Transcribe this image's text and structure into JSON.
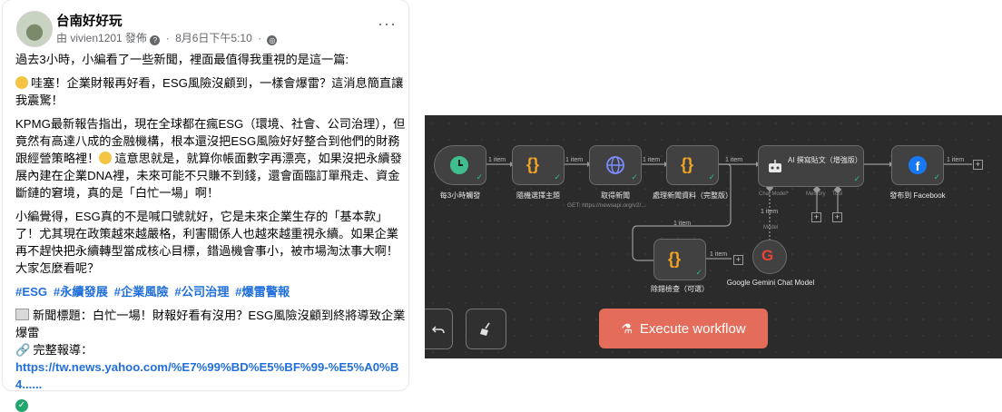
{
  "post": {
    "page_name": "台南好好玩",
    "byline": "由 vivien1201 發佈",
    "time": "8月6日下午5:10",
    "paragraphs": [
      "過去3小時，小編看了一些新聞，裡面最值得我重視的是這一篇:",
      "哇塞！企業財報再好看，ESG風險沒顧到，一樣會爆雷？這消息簡直讓我震驚！",
      "KPMG最新報告指出，現在全球都在瘋ESG（環境、社會、公司治理），但竟然有高達八成的金融機構，根本還沒把ESG風險好好整合到他們的財務跟經營策略裡！",
      "這意思就是，就算你帳面數字再漂亮，如果沒把永續發展內建在企業DNA裡，未來可能不只賺不到錢，還會面臨訂單飛走、資金斷鏈的窘境，真的是「白忙一場」啊！",
      "小編覺得，ESG真的不是喊口號就好，它是未來企業生存的「基本款」了！尤其現在政策越來越嚴格，利害關係人也越來越重視永續。如果企業再不趕快把永續轉型當成核心目標，錯過機會事小，被市場淘汰事大啊！大家怎麼看呢？"
    ],
    "hashtags": [
      "#ESG",
      "#永續發展",
      "#企業風險",
      "#公司治理",
      "#爆雷警報"
    ],
    "news_title": "新聞標題：白忙一場！財報好看有沒用？ESG風險沒顧到終將導致企業爆雷",
    "link_label": "完整報導：",
    "link_url": "https://tw.news.yahoo.com/%E7%99%BD%E5%BF%99-%E5%A0%B4......"
  },
  "workflow": {
    "nodes": {
      "trigger": "每3小時觸發",
      "random": "隨機選擇主題",
      "fetch": "取得新聞",
      "fetch_sub": "GET: https://newsapi.org/v2/...",
      "process": "處理新聞資料（完整版）",
      "ai": "AI 撰寫貼文（增強版）",
      "facebook": "發布到 Facebook",
      "dedupe": "除錯檢查（可選）",
      "gemini": "Google Gemini Chat Model"
    },
    "item_label": "1 item",
    "ports": {
      "chat_model": "Chat Model*",
      "memory": "Memory",
      "tool": "Tool",
      "model": "Model"
    },
    "execute_label": "Execute workflow",
    "colors": {
      "canvas": "#2b2b2b",
      "success": "#27c27b",
      "execute": "#e36d5a"
    }
  }
}
